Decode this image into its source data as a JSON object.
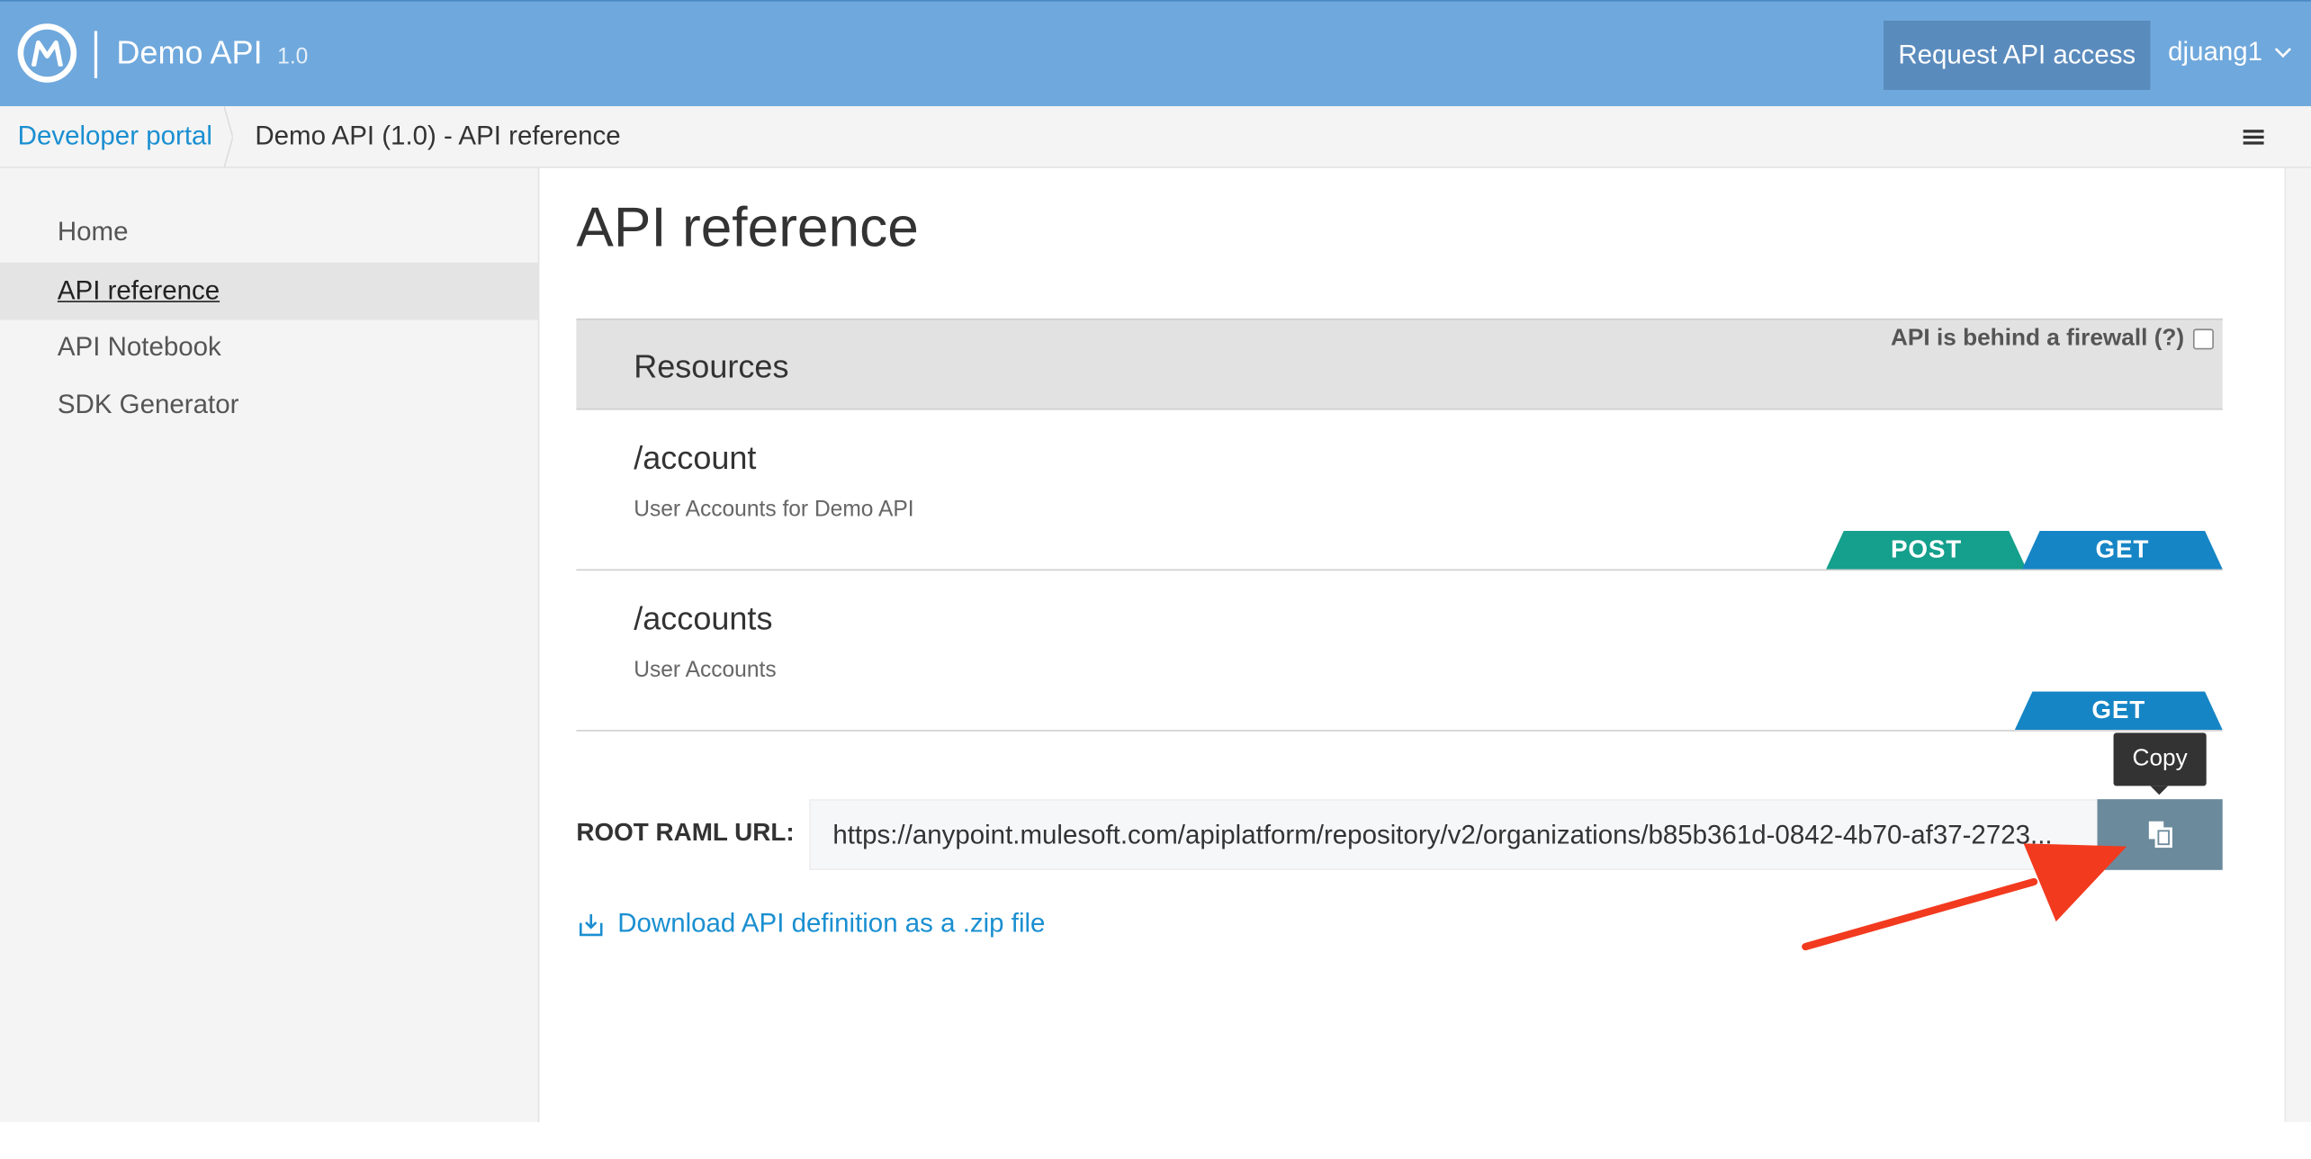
{
  "header": {
    "app_title": "Demo API",
    "app_version": "1.0",
    "request_button": "Request API access",
    "username": "djuang1",
    "logo_icon": "mulesoft-logo-icon"
  },
  "breadcrumb": {
    "portal_link": "Developer portal",
    "current": "Demo API (1.0) - API reference"
  },
  "sidebar": {
    "items": [
      {
        "label": "Home",
        "active": false
      },
      {
        "label": "API reference",
        "active": true
      },
      {
        "label": "API Notebook",
        "active": false
      },
      {
        "label": "SDK Generator",
        "active": false
      }
    ]
  },
  "main": {
    "title": "API reference",
    "resources_label": "Resources",
    "firewall_label": "API is behind a firewall (?)",
    "firewall_checked": false,
    "resources": [
      {
        "path": "/account",
        "description": "User Accounts for Demo API",
        "methods": [
          "POST",
          "GET"
        ]
      },
      {
        "path": "/accounts",
        "description": "User Accounts",
        "methods": [
          "GET"
        ]
      }
    ],
    "copy_tooltip": "Copy",
    "raml_label": "ROOT RAML URL:",
    "raml_url": "https://anypoint.mulesoft.com/apiplatform/repository/v2/organizations/b85b361d-0842-4b70-af37-2723...",
    "download_link": "Download API definition as a .zip file"
  },
  "colors": {
    "header_bg": "#6fa8dc",
    "request_button_bg": "#5a8bbd",
    "link": "#1a8fd1",
    "post": "#14a08c",
    "get": "#1585c5",
    "copy_button": "#6b8a9c",
    "annotation_arrow": "#f23a1f"
  }
}
